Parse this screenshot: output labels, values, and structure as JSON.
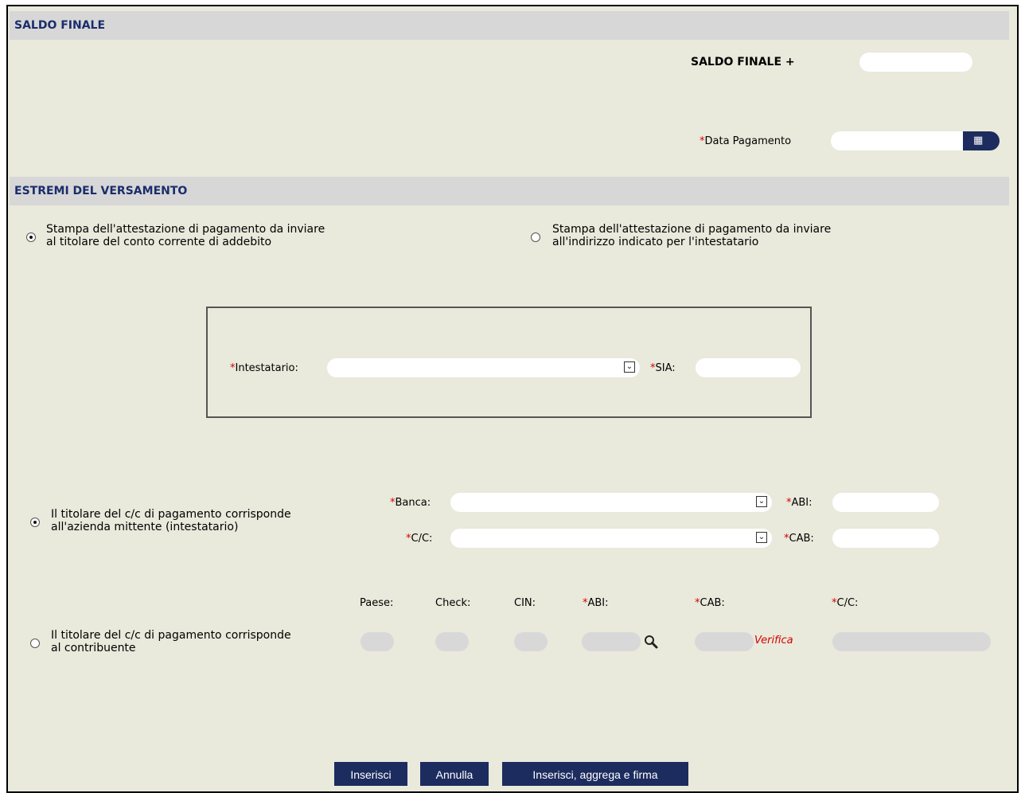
{
  "saldo_finale_section": {
    "header": "SALDO FINALE",
    "saldo_label": "SALDO FINALE +",
    "data_pagamento_label": "Data Pagamento"
  },
  "estremi_section": {
    "header": "ESTREMI DEL VERSAMENTO",
    "radio_titolare_line1": "Stampa dell'attestazione di pagamento da inviare",
    "radio_titolare_line2": "al titolare del conto corrente di addebito",
    "radio_intestatario_line1": "Stampa dell'attestazione di pagamento da inviare",
    "radio_intestatario_line2": "all'indirizzo indicato per l'intestatario"
  },
  "intestatario_box": {
    "intestatario_label": "Intestatario:",
    "sia_label": "SIA:"
  },
  "azienda": {
    "radio_line1": "Il titolare del c/c di pagamento corrisponde",
    "radio_line2": "all'azienda mittente (intestatario)",
    "banca_label": "Banca:",
    "abi_label": "ABI:",
    "cc_label": "C/C:",
    "cab_label": "CAB:"
  },
  "contribuente": {
    "radio_line1": "Il titolare del c/c di pagamento corrisponde",
    "radio_line2": "al contribuente",
    "paese_label": "Paese:",
    "check_label": "Check:",
    "cin_label": "CIN:",
    "abi_label": "ABI:",
    "cab_label": "CAB:",
    "cc_label": "C/C:",
    "verifica_link": "Verifica"
  },
  "required_marker": "*",
  "buttons": {
    "inserisci": "Inserisci",
    "annulla": "Annulla",
    "inserisci_aggrega_firma": "Inserisci, aggrega e firma"
  },
  "colors": {
    "background": "#e9e9dc",
    "section_bar": "#d7d7d7",
    "section_text": "#1a2d6b",
    "button": "#1c2c5e",
    "required": "#d40000"
  }
}
